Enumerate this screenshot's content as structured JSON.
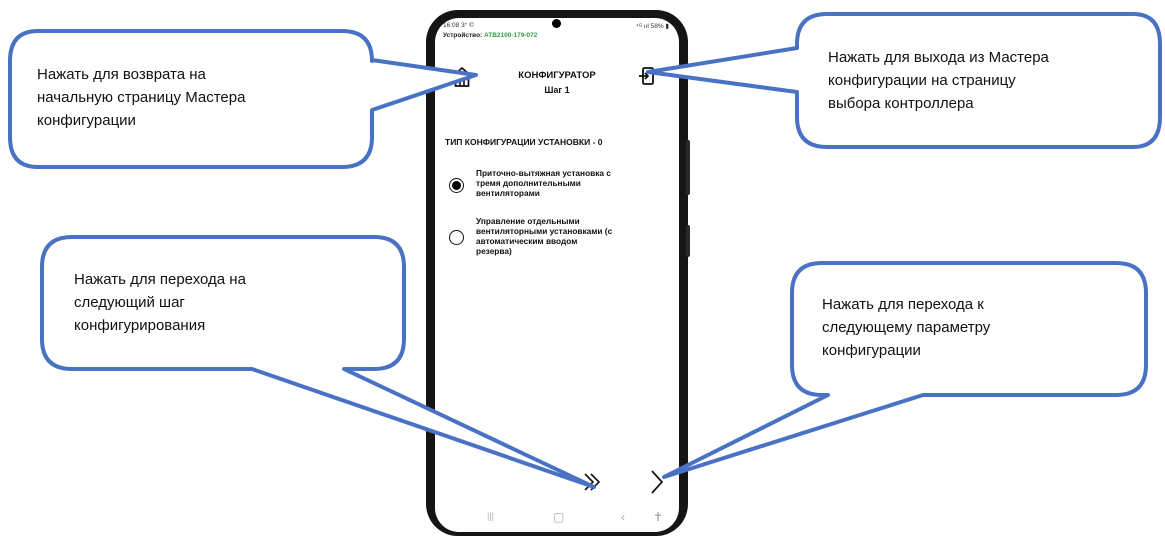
{
  "phone": {
    "status_bar": {
      "time": "16:08 3° ©",
      "right": "⁴ᴳ ııl 58% ▮"
    },
    "device": {
      "label": "Устройство:",
      "id": "ATB2100-179-072"
    },
    "header": {
      "title": "КОНФИГУРАТОР",
      "subtitle": "Шаг 1",
      "home_icon": "home-icon",
      "exit_icon": "exit-icon"
    },
    "config_type": "ТИП КОНФИГУРАЦИИ УСТАНОВКИ - 0",
    "options": [
      {
        "lines": [
          "Приточно-вытяжная установка с",
          "тремя дополнительными",
          "вентиляторами"
        ],
        "selected": true
      },
      {
        "lines": [
          "Управление отдельными",
          "вентиляторными установками (с",
          "автоматическим вводом",
          "резерва)"
        ],
        "selected": false
      }
    ],
    "nav": {
      "next_step_icon": "double-chevron-right-icon",
      "next_param_icon": "chevron-right-icon"
    },
    "system_bar": {
      "recents": "|||",
      "home": "▢",
      "back": "‹",
      "accessibility": "✝"
    }
  },
  "callouts": {
    "home": [
      "Нажать для возврата на",
      "начальную страницу Мастера",
      "конфигурации"
    ],
    "exit": [
      "Нажать для выхода из Мастера",
      "конфигурации на страницу",
      "выбора контроллера"
    ],
    "next_step": [
      "Нажать для перехода на",
      "следующий шаг",
      "конфигурирования"
    ],
    "next_param": [
      "Нажать для перехода к",
      "следующему параметру",
      "конфигурации"
    ]
  },
  "colors": {
    "callout_border": "#4a72c4",
    "callout_fill": "#ffffff",
    "phone_frame": "#151515",
    "device_id": "#2e9e44"
  }
}
